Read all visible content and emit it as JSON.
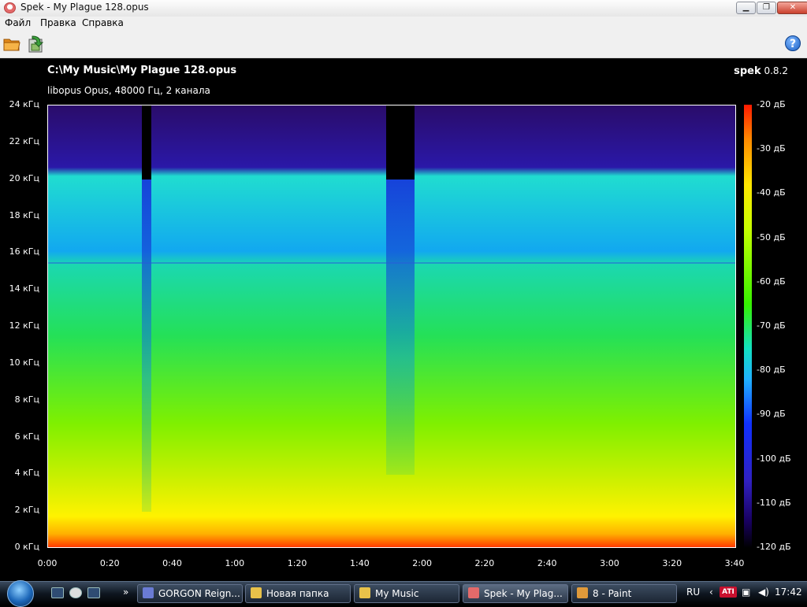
{
  "window": {
    "title": "Spek - My Plague 128.opus",
    "minimize": "▁",
    "maximize": "❐",
    "close": "✕"
  },
  "menu": {
    "items": [
      "Файл",
      "Правка",
      "Справка"
    ]
  },
  "toolbar": {
    "help_label": "?"
  },
  "spek": {
    "file_path": "C:\\My Music\\My Plague 128.opus",
    "info": "libopus Opus, 48000 Гц, 2 канала",
    "brand": "spek",
    "version": "0.8.2"
  },
  "chart_data": {
    "type": "heatmap",
    "title": "C:\\My Music\\My Plague 128.opus",
    "subtitle": "libopus Opus, 48000 Гц, 2 канала",
    "x_ticks": [
      "0:00",
      "0:20",
      "0:40",
      "1:00",
      "1:20",
      "1:40",
      "2:00",
      "2:20",
      "2:40",
      "3:00",
      "3:20",
      "3:40"
    ],
    "y_ticks": [
      "24 кГц",
      "22 кГц",
      "20 кГц",
      "18 кГц",
      "16 кГц",
      "14 кГц",
      "12 кГц",
      "10 кГц",
      "8 кГц",
      "6 кГц",
      "4 кГц",
      "2 кГц",
      "0 кГц"
    ],
    "xlim_seconds": [
      0,
      220
    ],
    "ylim_khz": [
      0,
      24
    ],
    "colorbar_ticks": [
      "-20 дБ",
      "-30 дБ",
      "-40 дБ",
      "-50 дБ",
      "-60 дБ",
      "-70 дБ",
      "-80 дБ",
      "-90 дБ",
      "-100 дБ",
      "-110 дБ",
      "-120 дБ"
    ],
    "cutoff_khz": 20,
    "secondary_cutoff_khz": 15.5,
    "low_energy_intervals_seconds": [
      [
        30,
        33
      ],
      [
        108,
        117
      ]
    ]
  },
  "taskbar": {
    "items": [
      {
        "label": "GORGON Reign...",
        "color": "#6a7bd4",
        "active": false
      },
      {
        "label": "Новая папка",
        "color": "#e8c24a",
        "active": false
      },
      {
        "label": "My Music",
        "color": "#e8c24a",
        "active": false
      },
      {
        "label": "Spek - My Plag...",
        "color": "#e36a6a",
        "active": true
      },
      {
        "label": "8 - Paint",
        "color": "#e09a3a",
        "active": false
      }
    ],
    "lang": "RU",
    "clock": "17:42",
    "chevron": "»"
  }
}
